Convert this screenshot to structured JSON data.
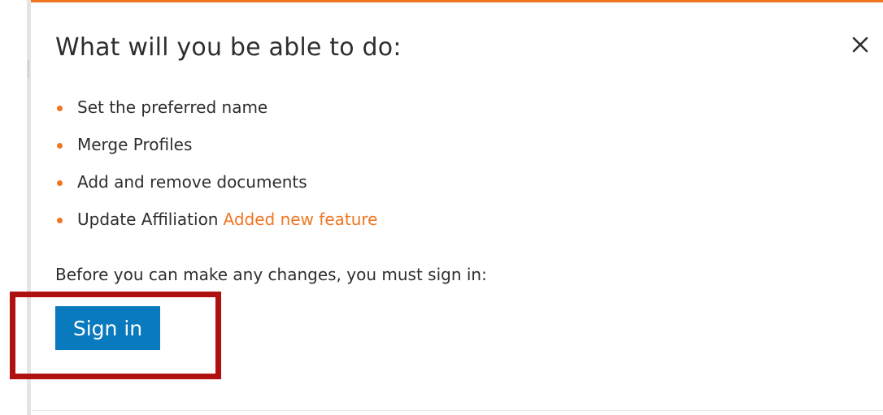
{
  "dialog": {
    "title": "What will you be able to do:",
    "close_icon": "close-icon",
    "features": [
      {
        "label": "Set the preferred name",
        "tag": ""
      },
      {
        "label": "Merge Profiles",
        "tag": ""
      },
      {
        "label": "Add and remove documents",
        "tag": ""
      },
      {
        "label": "Update Affiliation",
        "tag": "Added new feature"
      }
    ],
    "signin_note": "Before you can make any changes, you must sign in:",
    "signin_label": "Sign in"
  },
  "colors": {
    "accent": "#f07622",
    "button": "#0a7abf",
    "highlight": "#b01010",
    "text": "#2e2e2e"
  }
}
